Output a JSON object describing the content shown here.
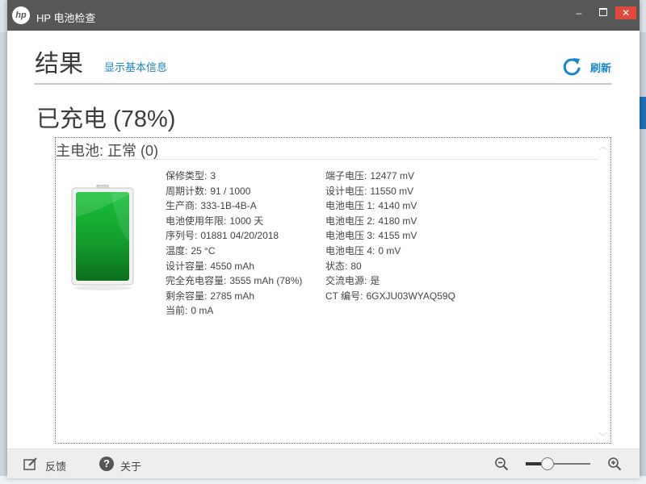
{
  "window": {
    "title": "HP 电池检查",
    "logo_text": "hp"
  },
  "controls": {
    "minimize": "–",
    "close": "✕"
  },
  "header": {
    "title": "结果",
    "basic_info_link": "显示基本信息",
    "refresh_label": "刷新"
  },
  "charge_status": "已充电 (78%)",
  "battery": {
    "panel_title": "主电池: 正常 (0)",
    "left_details": [
      {
        "label": "保修类型:",
        "value": "3"
      },
      {
        "label": "周期计数:",
        "value": "91 / 1000"
      },
      {
        "label": "生产商:",
        "value": "333-1B-4B-A"
      },
      {
        "label": "电池使用年限:",
        "value": "1000 天"
      },
      {
        "label": "序列号:",
        "value": "01881 04/20/2018"
      },
      {
        "label": "温度:",
        "value": "25 °C"
      },
      {
        "label": "设计容量:",
        "value": "4550 mAh"
      },
      {
        "label": "完全充电容量:",
        "value": "3555 mAh (78%)"
      },
      {
        "label": "剩余容量:",
        "value": "2785 mAh"
      },
      {
        "label": "当前:",
        "value": "0 mA"
      }
    ],
    "right_details": [
      {
        "label": "端子电压:",
        "value": "12477 mV"
      },
      {
        "label": "设计电压:",
        "value": "11550 mV"
      },
      {
        "label": "电池电压 1:",
        "value": "4140 mV"
      },
      {
        "label": "电池电压 2:",
        "value": "4180 mV"
      },
      {
        "label": "电池电压 3:",
        "value": "4155 mV"
      },
      {
        "label": "电池电压 4:",
        "value": "0 mV"
      },
      {
        "label": "状态:",
        "value": "80"
      },
      {
        "label": "交流电源:",
        "value": "是"
      },
      {
        "label": "CT 编号:",
        "value": "6GXJU03WYAQ59Q"
      }
    ],
    "graphic_color": "#1fb23a"
  },
  "footer": {
    "feedback_label": "反馈",
    "about_label": "关于",
    "zoom_level": 0.33
  },
  "colors": {
    "accent": "#1a86c7",
    "titlebar": "#575757",
    "close": "#e04a3d"
  }
}
